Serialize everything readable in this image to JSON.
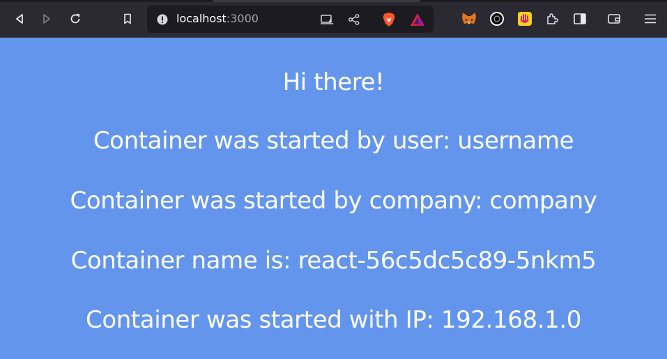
{
  "browser": {
    "url_host": "localhost",
    "url_port": ":3000",
    "toolbar_buttons": [
      "back-icon",
      "forward-icon",
      "reload-icon",
      "bookmark-icon"
    ],
    "url_icons": [
      "page-info-icon",
      "install-app-icon",
      "share-icon",
      "brave-shields-icon",
      "brave-rewards-icon"
    ],
    "extension_icons": [
      "metamask-icon",
      "extension-ring-icon",
      "extension-hand-icon",
      "extensions-puzzle-icon",
      "sidebar-icon",
      "wallet-icon",
      "menu-icon"
    ]
  },
  "page": {
    "background": "#6495ed",
    "greeting": "Hi there!",
    "user_line": "Container was started by user: username",
    "company_line": "Container was started by company: company",
    "name_line": "Container name is: react-56c5dc5c89-5nkm5",
    "ip_line": "Container was started with IP: 192.168.1.0"
  }
}
